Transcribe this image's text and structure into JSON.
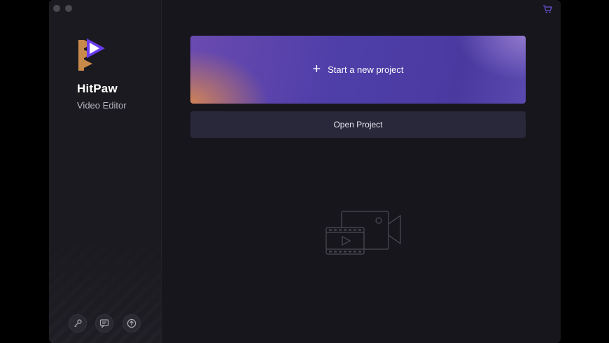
{
  "app": {
    "name": "HitPaw",
    "subtitle": "Video Editor"
  },
  "main": {
    "start_label": "Start a new project",
    "start_icon": "plus-icon",
    "open_label": "Open Project"
  },
  "sidebar": {
    "buttons": [
      {
        "icon": "key-icon"
      },
      {
        "icon": "feedback-icon"
      },
      {
        "icon": "upgrade-icon"
      }
    ]
  },
  "toolbar": {
    "cart_icon": "cart-icon"
  },
  "colors": {
    "accent": "#5a44b0",
    "logo_orange": "#c88a4a",
    "logo_purple": "#6a3cf0"
  }
}
